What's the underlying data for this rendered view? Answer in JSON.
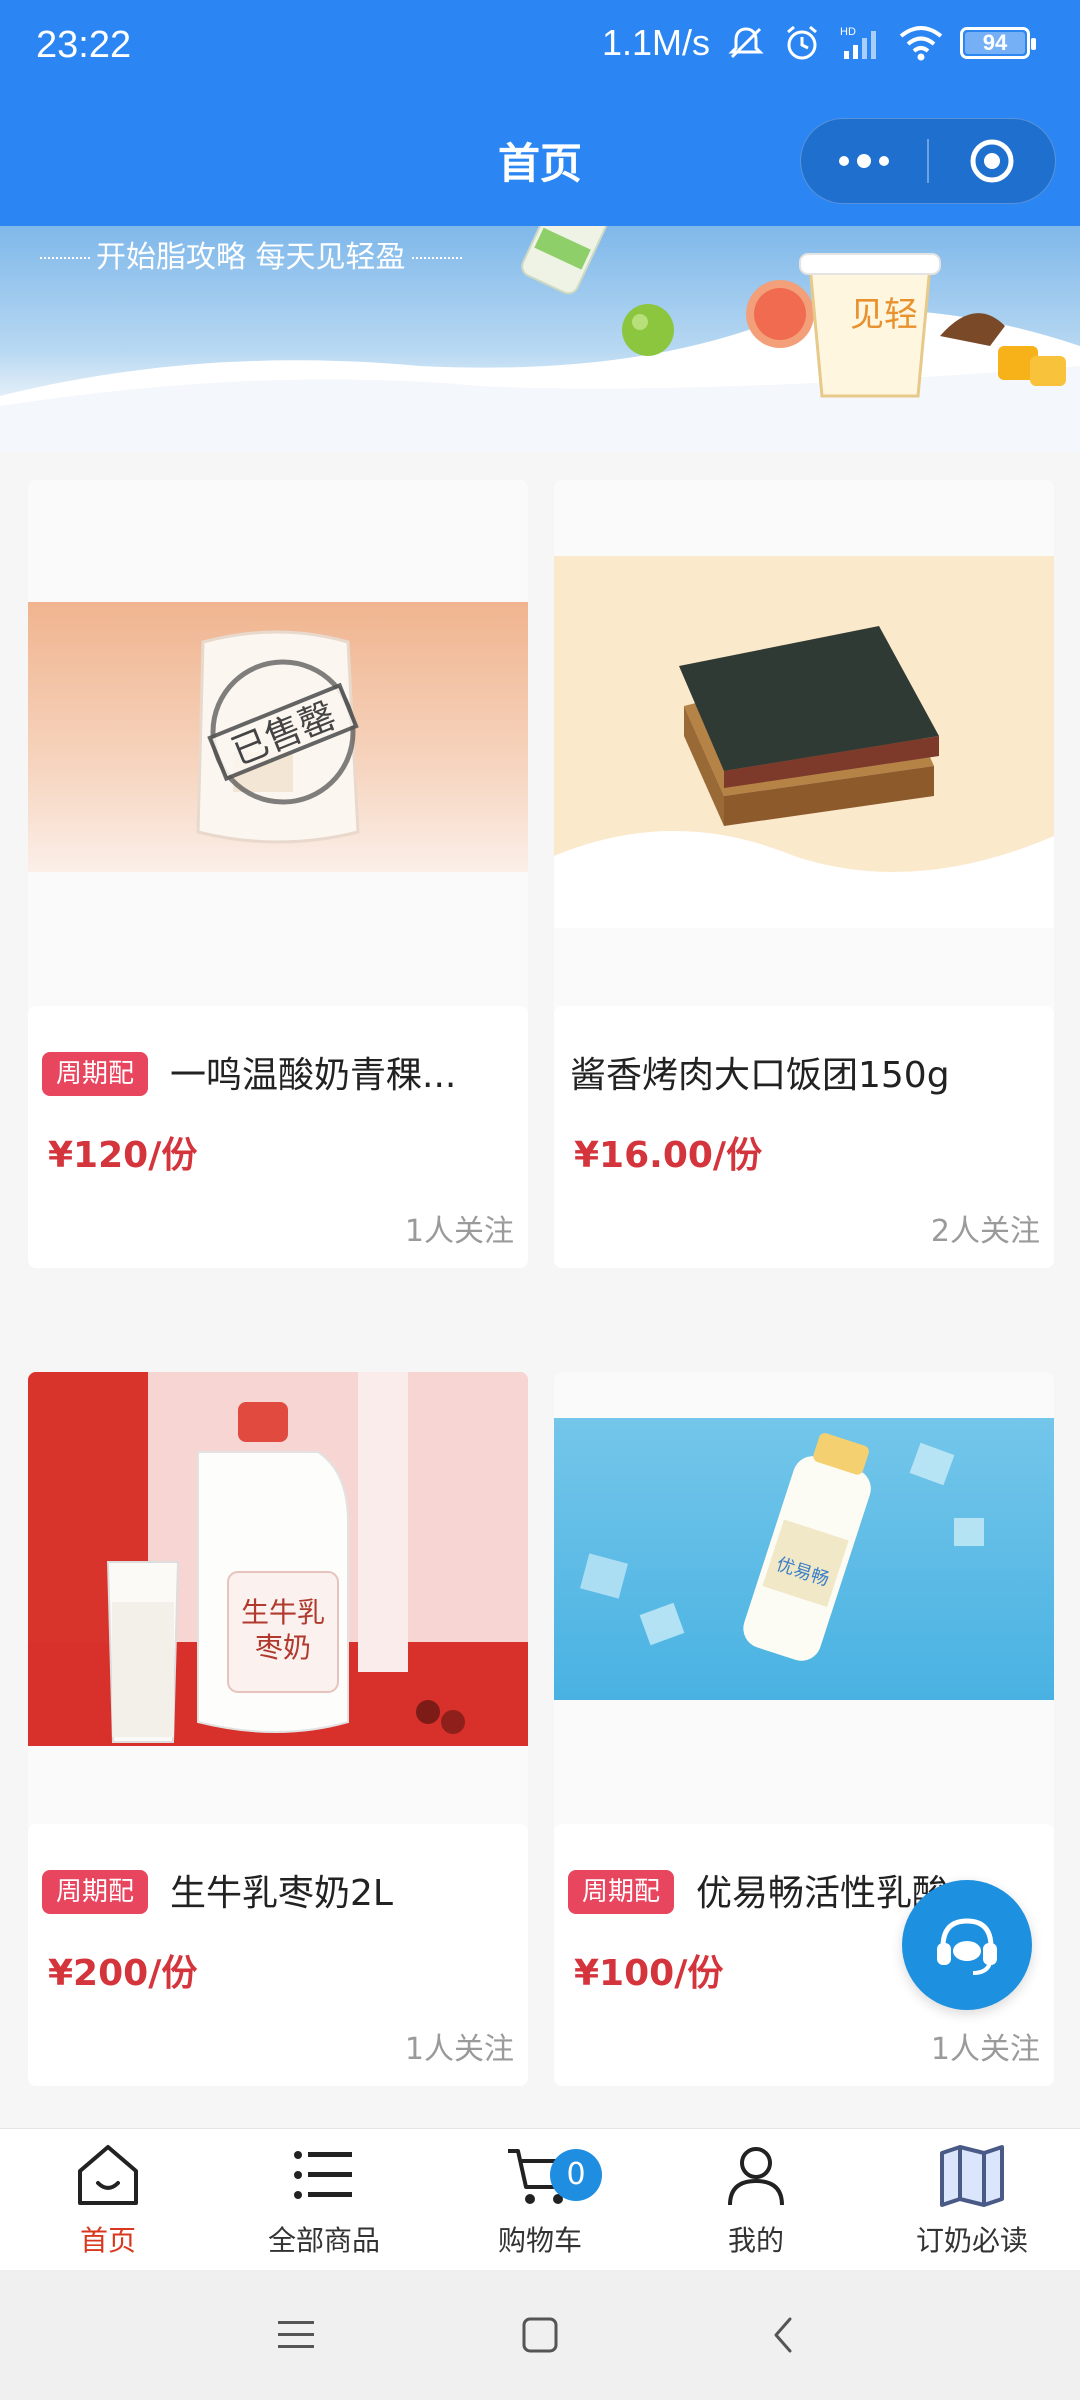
{
  "status_bar": {
    "time": "23:22",
    "speed": "1.1M/s",
    "battery": "94",
    "battery_level": 0.94
  },
  "header": {
    "title": "首页"
  },
  "banner": {
    "slogan": "开始脂攻略  每天见轻盈"
  },
  "products": [
    {
      "tag": "周期配",
      "name": "一鸣温酸奶青稞...",
      "price": "¥120/份",
      "followers": "1人关注",
      "stamp": "已售罄"
    },
    {
      "tag": "",
      "name": "酱香烤肉大口饭团150g",
      "price": "¥16.00/份",
      "followers": "2人关注"
    },
    {
      "tag": "周期配",
      "name": "生牛乳枣奶2L",
      "price": "¥200/份",
      "followers": "1人关注"
    },
    {
      "tag": "周期配",
      "name": "优易畅活性乳酸",
      "price": "¥100/份",
      "followers": "1人关注"
    }
  ],
  "tabbar": {
    "items": [
      {
        "label": "首页",
        "icon": "home-icon",
        "active": true
      },
      {
        "label": "全部商品",
        "icon": "list-icon"
      },
      {
        "label": "购物车",
        "icon": "cart-icon",
        "badge": "0"
      },
      {
        "label": "我的",
        "icon": "user-icon"
      },
      {
        "label": "订奶必读",
        "icon": "map-icon"
      }
    ]
  },
  "colors": {
    "primary": "#2b86f3",
    "price": "#d4343b",
    "tag": "#e8455e",
    "active_tab": "#d9381e"
  }
}
